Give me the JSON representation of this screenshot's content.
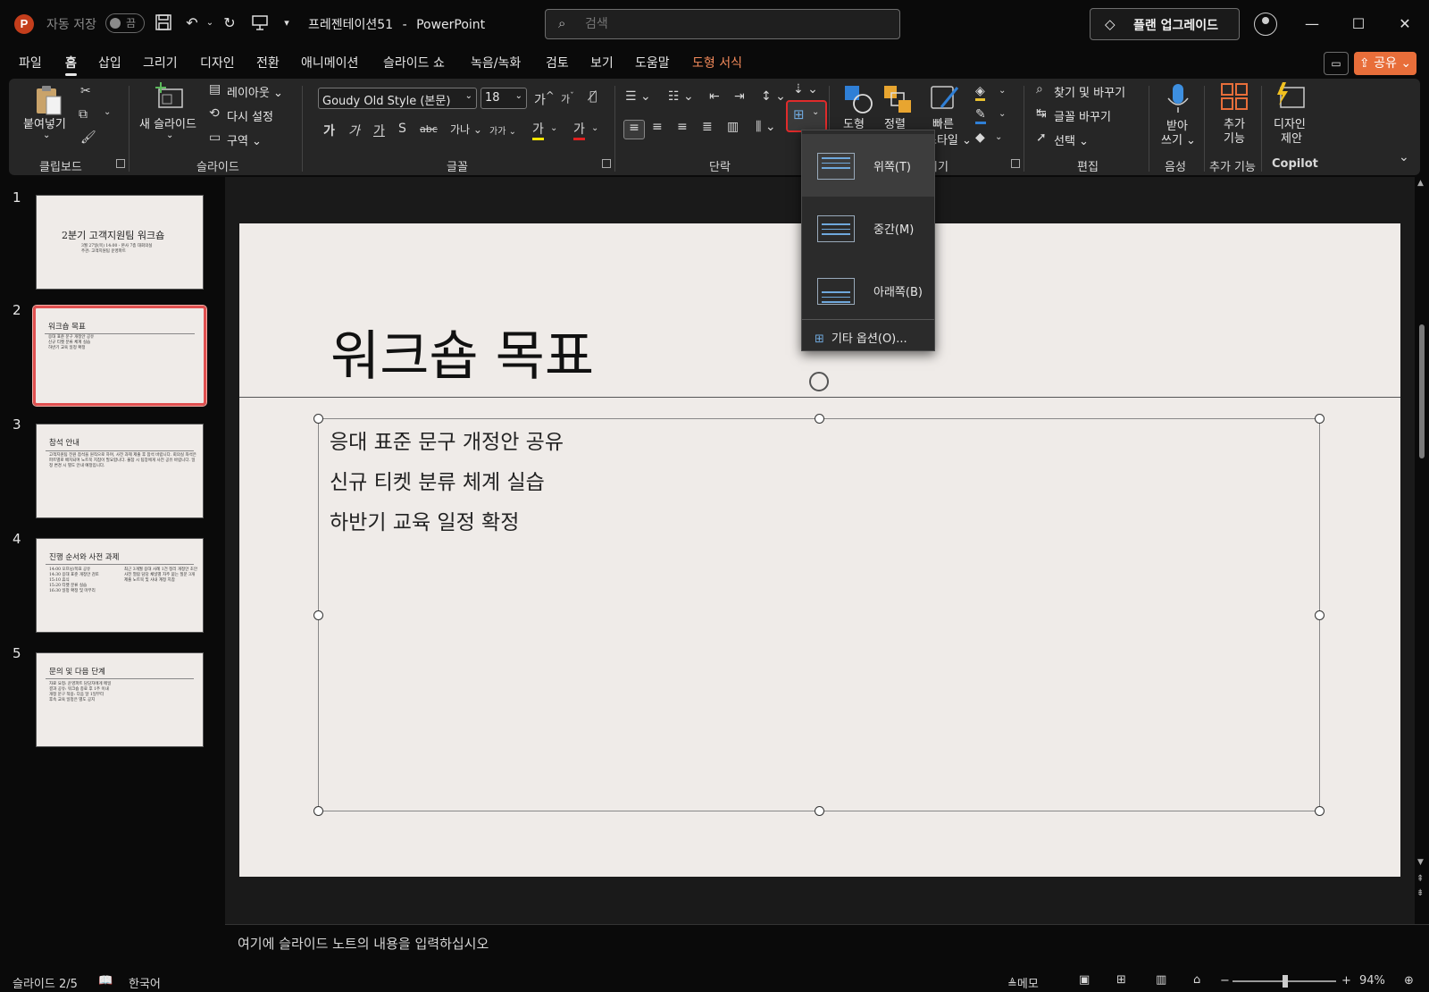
{
  "titlebar": {
    "app_logo": "P",
    "autosave_label": "자동 저장",
    "autosave_state": "끔",
    "doc_name": "프레젠테이션51",
    "separator": "-",
    "app_name": "PowerPoint",
    "search_placeholder": "검색",
    "upgrade_label": "플랜 업그레이드",
    "icons": [
      "save-icon",
      "undo-icon",
      "redo-icon",
      "present-icon",
      "customize-icon",
      "diamond-icon",
      "avatar-icon",
      "minimize-icon",
      "maximize-icon",
      "close-icon"
    ]
  },
  "tabs": [
    "파일",
    "홈",
    "삽입",
    "그리기",
    "디자인",
    "전환",
    "애니메이션",
    "슬라이드 쇼",
    "녹음/녹화",
    "검토",
    "보기",
    "도움말",
    "도형 서식"
  ],
  "active_tab": "홈",
  "share_label": "공유",
  "ribbon": {
    "clipboard": {
      "paste": "붙여넣기",
      "group": "클립보드"
    },
    "slides": {
      "new_slide": "새 슬라이드",
      "layout": "레이아웃",
      "reset": "다시 설정",
      "section": "구역",
      "group": "슬라이드"
    },
    "font": {
      "font_name": "Goudy Old Style (본문)",
      "font_size": "18",
      "bold": "가",
      "italic": "가",
      "underline": "가",
      "shadow": "S",
      "strike": "abc",
      "spacing": "가나",
      "case": "가가",
      "highlight": "가",
      "font_color": "가",
      "group": "글꼴"
    },
    "paragraph": {
      "group": "단락"
    },
    "drawing": {
      "shapes": "도형",
      "arrange": "정렬",
      "quick_styles_1": "빠른",
      "quick_styles_2": "스타일",
      "group_suffix": "리기"
    },
    "editing": {
      "find_replace": "찾기 및 바꾸기",
      "replace_font": "글꼴 바꾸기",
      "select": "선택",
      "group": "편집"
    },
    "voice": {
      "dictate_1": "받아",
      "dictate_2": "쓰기",
      "group": "음성"
    },
    "addins": {
      "label_1": "추가",
      "label_2": "기능",
      "group": "추가 기능"
    },
    "designer": {
      "label_1": "디자인",
      "label_2": "제안",
      "group": "Copilot"
    }
  },
  "valign_menu": {
    "top": "위쪽(T)",
    "middle": "중간(M)",
    "bottom": "아래쪽(B)",
    "more": "기타 옵션(O)..."
  },
  "thumbnails": [
    {
      "num": "1",
      "title": "2분기 고객지원팀 워크숍",
      "sub": "3월 27일(목) 14:00 - 본사 7층 대회의실\n주관: 고객지원팀 운영파트"
    },
    {
      "num": "2",
      "title": "워크숍 목표",
      "body": "응대 표준 문구 개정안 공유\n신규 티켓 분류 체계 실습\n하반기 교육 일정 확정"
    },
    {
      "num": "3",
      "title": "참석 안내",
      "body": "고객지원팀 전원 참석을 원칙으로 하며, 사전 과제 제출 후 참석 바랍니다. 회의실 좌석은 파트별로 배치되며 노트북 지참이 필요합니다. 불참 시 팀장에게 사전 공유 바랍니다. 일정 변경 시 별도 안내 예정입니다."
    },
    {
      "num": "4",
      "title": "진행 순서와 사전 과제",
      "body": "14:00 오프닝/목표 공유\n14:30 응대 표준 개정안 검토\n15:10 휴식\n15:20 티켓 분류 실습\n16:30 일정 확정 및 마무리",
      "body2": "최근 3개월 응대 사례 1건 정리\n개정안 초안 사전 열람\n담당 채널별 자주 묻는 질문 3개 제출\n노트북 및 사내 계정 지참"
    },
    {
      "num": "5",
      "title": "문의 및 다음 단계",
      "body": "자료 요청: 운영파트 담당자에게 메일\n결과 공유: 워크숍 종료 후 1주 이내\n개정 문구 적용: 다음 달 1일부터\n후속 교육 일정은 별도 공지"
    }
  ],
  "slide": {
    "title": "워크숍 목표",
    "bullets": [
      "응대 표준 문구 개정안 공유",
      "신규 티켓 분류 체계 실습",
      "하반기 교육 일정 확정"
    ]
  },
  "notes_placeholder": "여기에 슬라이드 노트의 내용을 입력하십시오",
  "status": {
    "slide_counter": "슬라이드 2/5",
    "language": "한국어",
    "notes": "메모",
    "zoom": "94%"
  }
}
